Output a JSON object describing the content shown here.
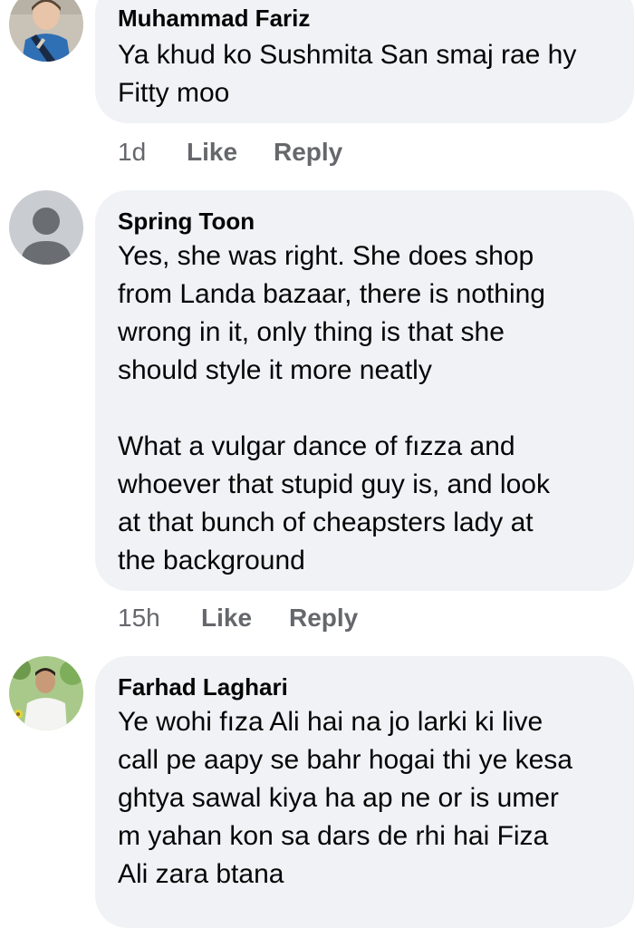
{
  "comments": [
    {
      "author": "Muhammad Fariz",
      "lines": [
        "Ya khud ko Sushmita San smaj rae hy",
        "Fitty moo"
      ],
      "time": "1d",
      "like_label": "Like",
      "reply_label": "Reply",
      "avatar_icon": "child-photo-avatar"
    },
    {
      "author": "Spring Toon",
      "lines": [
        "Yes, she was right. She does shop",
        "from Landa bazaar, there is nothing",
        "wrong in it, only thing is that she",
        "should style it more neatly",
        "",
        "What a vulgar dance of fızza and",
        "whoever that stupid guy is, and look",
        "at that bunch of cheapsters lady at",
        "the background"
      ],
      "time": "15h",
      "like_label": "Like",
      "reply_label": "Reply",
      "avatar_icon": "default-person-avatar"
    },
    {
      "author": "Farhad Laghari",
      "lines": [
        "Ye wohi fıza Ali hai na jo larki ki live",
        "call pe aapy se bahr hogai thi ye kesa",
        "ghtya sawal kiya ha ap ne or is umer",
        "m yahan kon sa dars de rhi hai Fiza",
        "Ali zara btana"
      ],
      "avatar_icon": "man-photo-avatar"
    }
  ],
  "colors": {
    "bubble": "#f0f2f5",
    "meta_text": "#65676b",
    "text": "#050505"
  }
}
